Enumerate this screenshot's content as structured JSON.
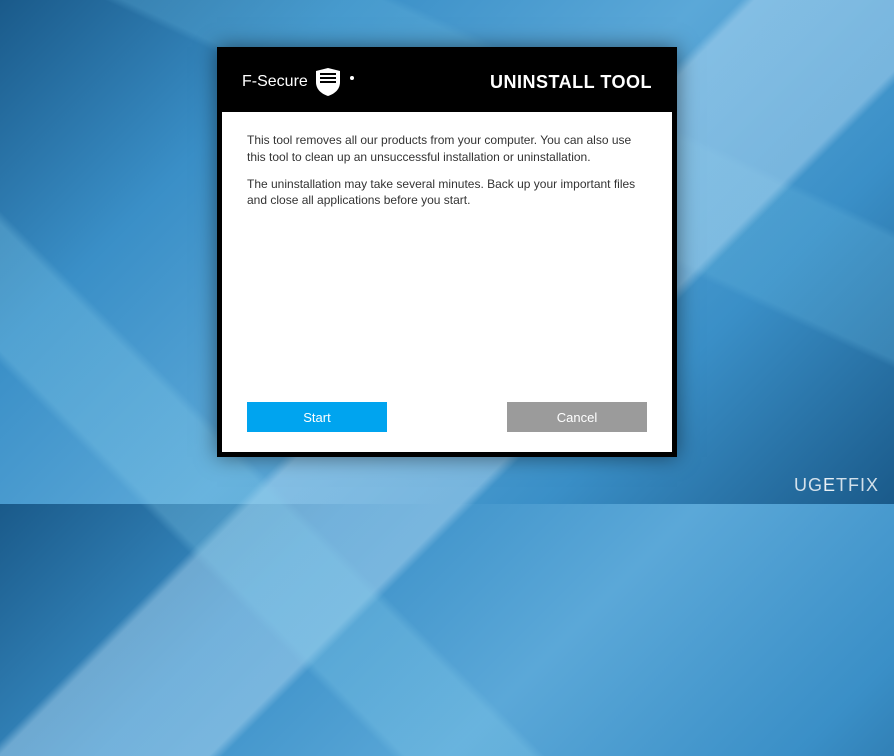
{
  "header": {
    "brand": "F-Secure",
    "title": "UNINSTALL TOOL"
  },
  "content": {
    "paragraph1": "This tool removes all our products from your computer. You can also use this tool to clean up an unsuccessful installation or uninstallation.",
    "paragraph2": "The uninstallation may take several minutes. Back up your important files and close all applications before you start."
  },
  "buttons": {
    "start_label": "Start",
    "cancel_label": "Cancel"
  },
  "watermark": {
    "text": "UGETFIX"
  }
}
